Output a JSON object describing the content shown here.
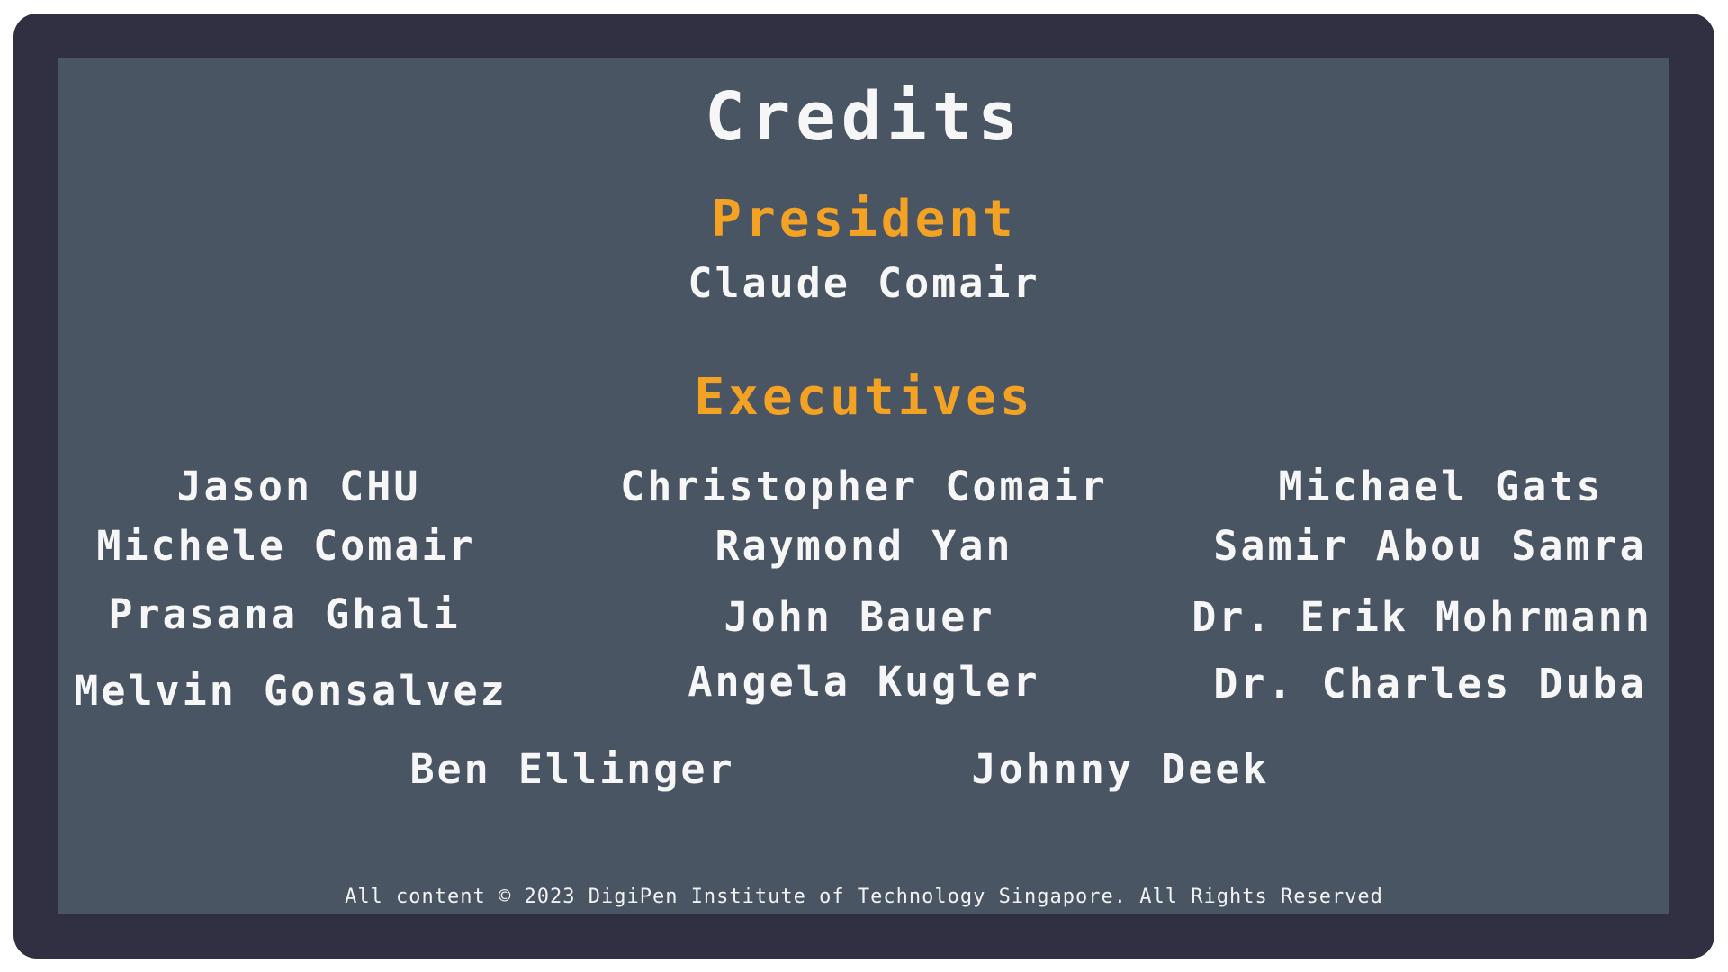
{
  "title": "Credits",
  "sections": {
    "president": {
      "heading": "President",
      "name": "Claude Comair"
    },
    "executives": {
      "heading": "Executives",
      "names": [
        "Jason CHU",
        "Christopher Comair",
        "Michael Gats",
        "Michele Comair",
        "Raymond Yan",
        "Samir Abou Samra",
        "Prasana Ghali",
        "John Bauer",
        "Dr. Erik Mohrmann",
        "Melvin Gonsalvez",
        "Angela Kugler",
        "Dr. Charles Duba",
        "Ben Ellinger",
        "Johnny Deek"
      ]
    }
  },
  "footer": "All content © 2023 DigiPen Institute of Technology Singapore. All Rights Reserved",
  "colors": {
    "frame": "#312f42",
    "panel": "#4a5564",
    "heading": "#f4a223",
    "text": "#f6f6f6"
  }
}
